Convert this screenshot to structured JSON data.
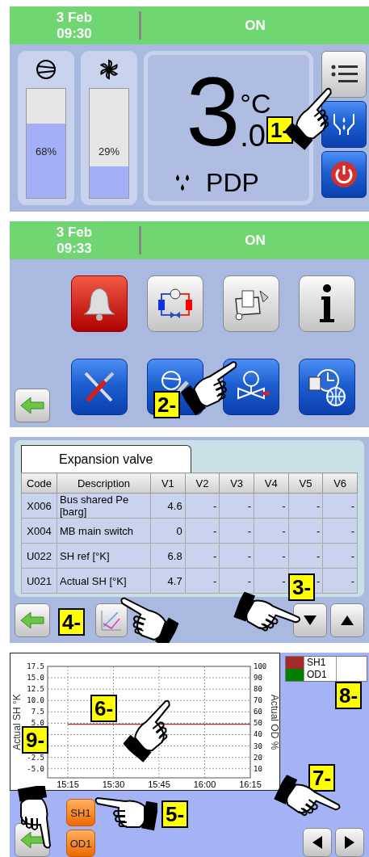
{
  "screens": [
    {
      "kind": "home",
      "header": {
        "date": "3 Feb",
        "time": "09:30",
        "status": "ON"
      },
      "gauges": [
        {
          "kind": "compressor",
          "level": 0.68,
          "reading": "68%"
        },
        {
          "kind": "fan",
          "level": 0.29,
          "reading": "29%"
        }
      ],
      "display": {
        "integer": "3",
        "decimal": ".0",
        "unit": "°C",
        "label": "PDP"
      },
      "side_buttons": [
        {
          "kind": "menu"
        },
        {
          "kind": "dryer"
        },
        {
          "kind": "power"
        }
      ],
      "callouts": [
        "1-"
      ]
    },
    {
      "kind": "menu",
      "header": {
        "date": "3 Feb",
        "time": "09:33",
        "status": "ON"
      },
      "tiles": [
        {
          "kind": "bell"
        },
        {
          "kind": "circuit"
        },
        {
          "kind": "toolbox"
        },
        {
          "kind": "info"
        },
        {
          "kind": "tools"
        },
        {
          "kind": "compressor"
        },
        {
          "kind": "valve"
        },
        {
          "kind": "clock"
        }
      ],
      "callouts": [
        "2-"
      ]
    },
    {
      "kind": "table",
      "tab": "Expansion valve",
      "columns": [
        "Code",
        "Description",
        "V1",
        "V2",
        "V3",
        "V4",
        "V5",
        "V6"
      ],
      "rows": [
        [
          "X006",
          "Bus shared Pe [barg]",
          "4.6",
          "-",
          "-",
          "-",
          "-",
          "-"
        ],
        [
          "X004",
          "MB main switch",
          "0",
          "-",
          "-",
          "-",
          "-",
          "-"
        ],
        [
          "U022",
          "SH ref [°K]",
          "6.8",
          "-",
          "-",
          "-",
          "-",
          "-"
        ],
        [
          "U021",
          "Actual SH [°K]",
          "4.7",
          "-",
          "-",
          "-",
          "-",
          "-"
        ]
      ],
      "callouts": [
        "4-",
        "3-"
      ]
    },
    {
      "kind": "chart",
      "chart_data": {
        "type": "line",
        "grid": true,
        "ylabel": "Actual SH °K",
        "x": [
          "15:15",
          "15:30",
          "15:45",
          "16:00",
          "16:15"
        ],
        "ylim": [
          -7,
          17.5
        ],
        "yticks": [
          {
            "value": 17.5,
            "label": "17.5"
          },
          {
            "value": 15,
            "label": "15.0"
          },
          {
            "value": 12.5,
            "label": "12.5"
          },
          {
            "value": 10,
            "label": "10.0"
          },
          {
            "value": 7.5,
            "label": "7.5"
          },
          {
            "value": 5,
            "label": "5.0"
          },
          {
            "value": -2.5,
            "label": "-2.5"
          },
          {
            "value": -5,
            "label": "-5.0"
          }
        ],
        "series": [
          {
            "name": "SH1",
            "color": "#a52a2a",
            "values": [
              4.8,
              4.8,
              4.8,
              4.8,
              4.8
            ]
          },
          {
            "name": "OD1",
            "color": "#008000",
            "values": [
              null,
              null,
              null,
              null,
              null
            ]
          }
        ]
      },
      "right_axis": {
        "label": "Actual OD %",
        "ticks": [
          "100",
          "90",
          "80",
          "70",
          "60",
          "50",
          "40",
          "30",
          "20",
          "10"
        ]
      },
      "series_buttons": [
        "SH1",
        "OD1"
      ],
      "callouts": [
        "6-",
        "8-",
        "9-",
        "5-",
        "7-"
      ]
    }
  ]
}
